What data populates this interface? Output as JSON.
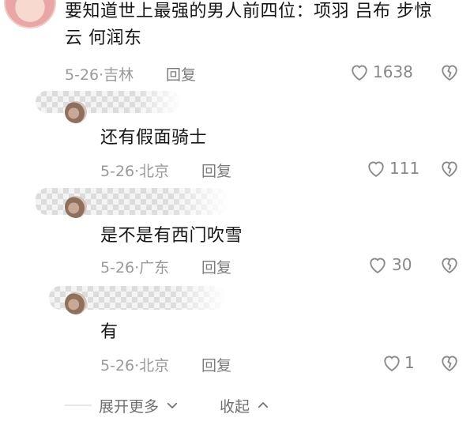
{
  "comments": [
    {
      "text_line1": "要知道世上最强的男人前四位：项羽 吕布 步惊",
      "text_line2": "云 何润东",
      "date": "5-26",
      "location": "吉林",
      "reply_label": "回复",
      "likes": "1638"
    },
    {
      "text": "还有假面骑士",
      "date": "5-26",
      "location": "北京",
      "reply_label": "回复",
      "likes": "111"
    },
    {
      "text": "是不是有西门吹雪",
      "date": "5-26",
      "location": "广东",
      "reply_label": "回复",
      "likes": "30"
    },
    {
      "text": "有",
      "date": "5-26",
      "location": "北京",
      "reply_label": "回复",
      "likes": "1"
    }
  ],
  "footer": {
    "expand_label": "展开更多",
    "collapse_label": "收起"
  },
  "icons": {
    "like": "heart-outline-icon",
    "dislike": "broken-heart-icon",
    "expand": "chevron-down-icon",
    "collapse": "chevron-up-icon"
  }
}
